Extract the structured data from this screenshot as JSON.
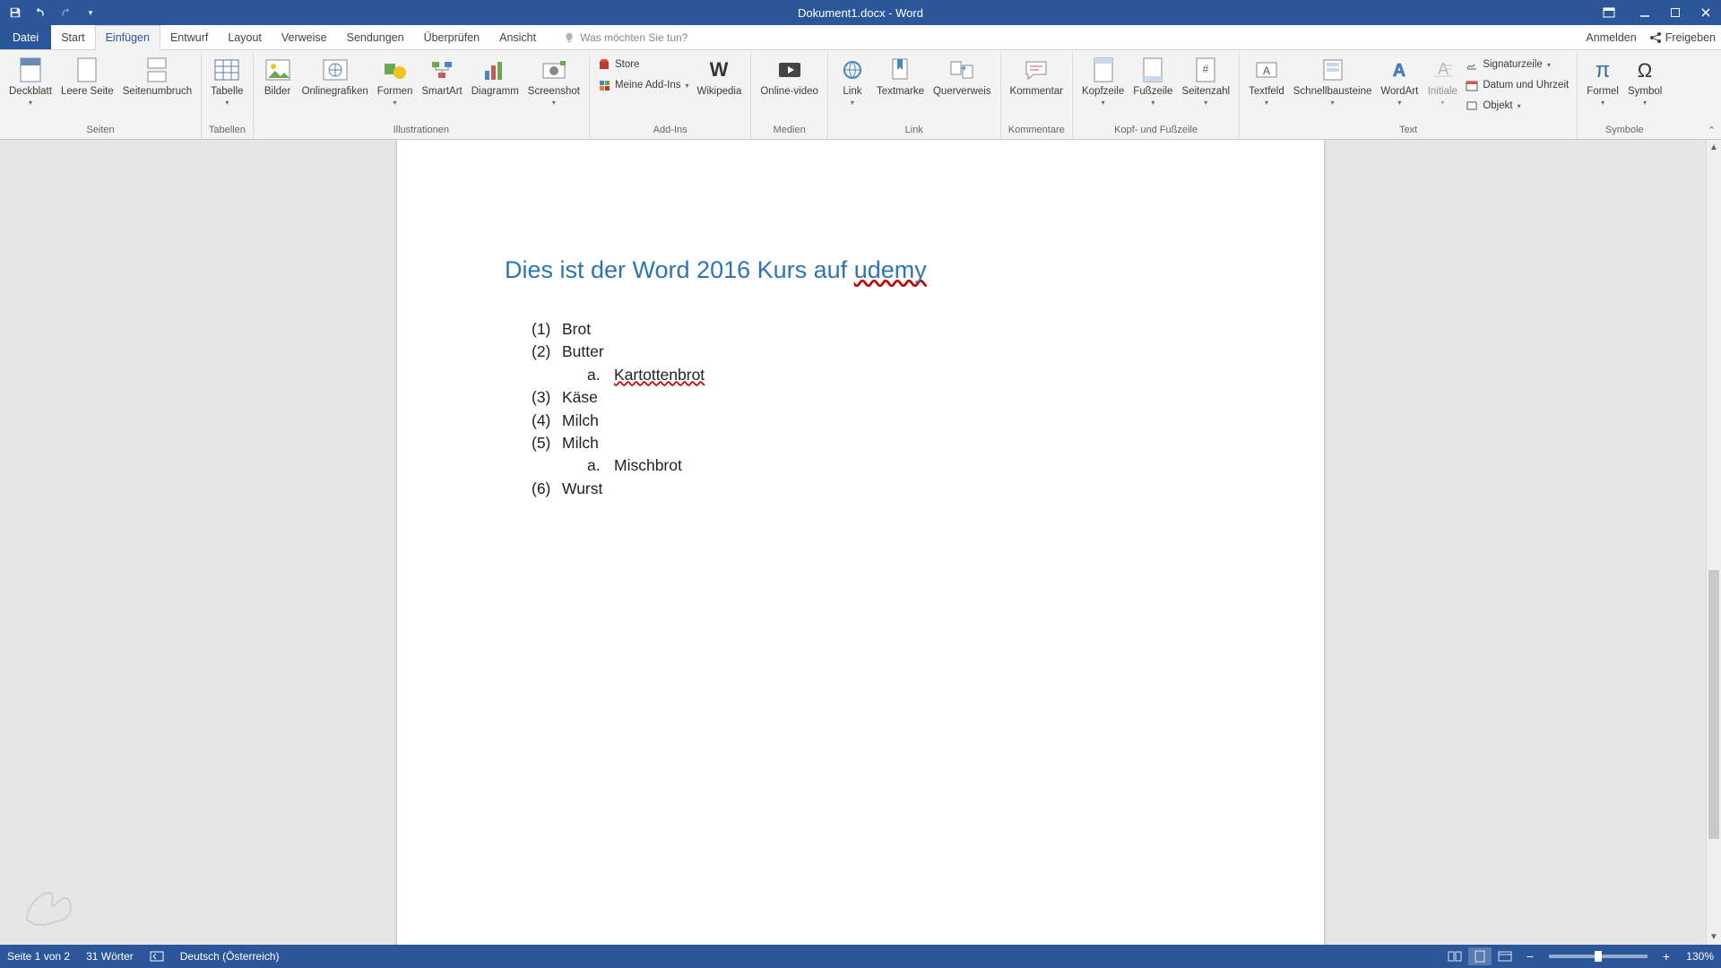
{
  "title": "Dokument1.docx - Word",
  "tabs": {
    "file": "Datei",
    "home": "Start",
    "insert": "Einfügen",
    "design": "Entwurf",
    "layout": "Layout",
    "references": "Verweise",
    "mailings": "Sendungen",
    "review": "Überprüfen",
    "view": "Ansicht"
  },
  "tellme": "Was möchten Sie tun?",
  "right": {
    "signin": "Anmelden",
    "share": "Freigeben"
  },
  "ribbon": {
    "seiten": {
      "label": "Seiten",
      "deckblatt": "Deckblatt",
      "leere": "Leere Seite",
      "umbruch": "Seitenumbruch"
    },
    "tabellen": {
      "label": "Tabellen",
      "tabelle": "Tabelle"
    },
    "illustrationen": {
      "label": "Illustrationen",
      "bilder": "Bilder",
      "onlinegrafiken": "Onlinegrafiken",
      "formen": "Formen",
      "smartart": "SmartArt",
      "diagramm": "Diagramm",
      "screenshot": "Screenshot"
    },
    "addins": {
      "label": "Add-Ins",
      "store": "Store",
      "meine": "Meine Add-Ins",
      "wikipedia": "Wikipedia"
    },
    "medien": {
      "label": "Medien",
      "onlinevideo": "Online-video"
    },
    "link": {
      "label": "Link",
      "link": "Link",
      "textmarke": "Textmarke",
      "querverweis": "Querverweis"
    },
    "kommentare": {
      "label": "Kommentare",
      "kommentar": "Kommentar"
    },
    "kopf": {
      "label": "Kopf- und Fußzeile",
      "kopfzeile": "Kopfzeile",
      "fusszeile": "Fußzeile",
      "seitenzahl": "Seitenzahl"
    },
    "text": {
      "label": "Text",
      "textfeld": "Textfeld",
      "schnellbausteine": "Schnellbausteine",
      "wordart": "WordArt",
      "initiale": "Initiale",
      "signatur": "Signaturzeile",
      "datum": "Datum und Uhrzeit",
      "objekt": "Objekt"
    },
    "symbole": {
      "label": "Symbole",
      "formel": "Formel",
      "symbol": "Symbol"
    }
  },
  "doc": {
    "heading_pre": "Dies ist der Word 2016 Kurs auf ",
    "heading_err": "udemy",
    "items": [
      {
        "n": "(1)",
        "t": "Brot"
      },
      {
        "n": "(2)",
        "t": "Butter"
      },
      {
        "n": "(3)",
        "t": "Käse"
      },
      {
        "n": "(4)",
        "t": "Milch"
      },
      {
        "n": "(5)",
        "t": "Milch"
      },
      {
        "n": "(6)",
        "t": "Wurst"
      }
    ],
    "sub1": {
      "n": "a.",
      "t": "Kartottenbrot"
    },
    "sub2": {
      "n": "a.",
      "t": "Mischbrot"
    }
  },
  "status": {
    "page": "Seite 1 von 2",
    "words": "31 Wörter",
    "lang": "Deutsch (Österreich)",
    "zoom": "130%"
  }
}
